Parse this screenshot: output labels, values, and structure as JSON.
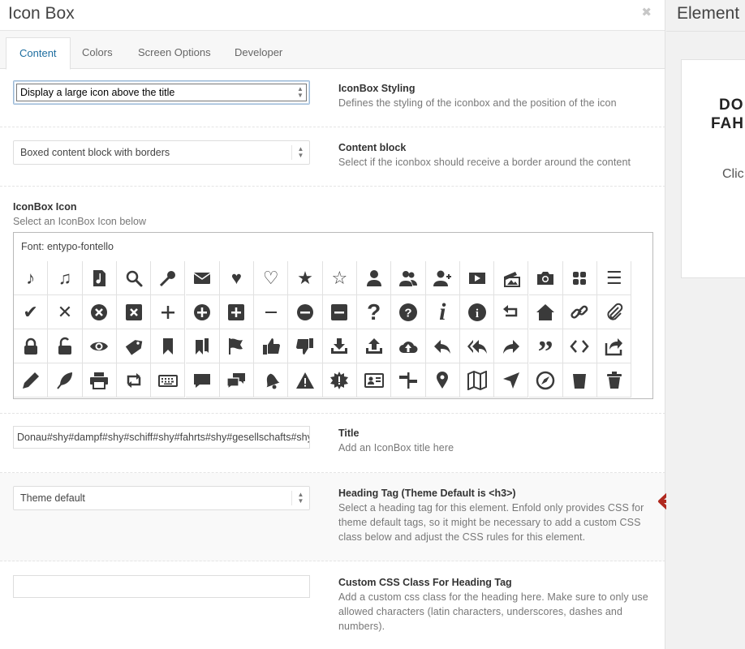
{
  "modal": {
    "title": "Icon Box",
    "close_symbol": "✖",
    "tabs": [
      {
        "label": "Content",
        "active": true
      },
      {
        "label": "Colors",
        "active": false
      },
      {
        "label": "Screen Options",
        "active": false
      },
      {
        "label": "Developer",
        "active": false
      }
    ]
  },
  "styling": {
    "selected": "Display a large icon above the title",
    "title": "IconBox Styling",
    "desc": "Defines the styling of the iconbox and the position of the icon"
  },
  "content_block": {
    "selected": "Boxed content block with borders",
    "title": "Content block",
    "desc": "Select if the iconbox should receive a border around the content"
  },
  "icon_section": {
    "title": "IconBox Icon",
    "desc": "Select an IconBox Icon below",
    "font_label": "Font: entypo-fontello",
    "icons": [
      "note-icon",
      "music-icon",
      "music-file-icon",
      "search-icon",
      "key-icon",
      "mail-icon",
      "heart-icon",
      "heart-outline-icon",
      "star-icon",
      "star-outline-icon",
      "user-icon",
      "users-icon",
      "user-add-icon",
      "video-icon",
      "picture-icon",
      "camera-icon",
      "grid-icon",
      "menu-icon",
      "check-icon",
      "cancel-icon",
      "cancel-circle-icon",
      "cancel-square-icon",
      "plus-icon",
      "plus-circle-icon",
      "plus-square-icon",
      "minus-icon",
      "minus-circle-icon",
      "minus-square-icon",
      "help-icon",
      "help-circle-icon",
      "info-icon",
      "info-circle-icon",
      "back-icon",
      "home-icon",
      "link-icon",
      "attach-icon",
      "lock-icon",
      "lock-open-icon",
      "eye-icon",
      "tag-icon",
      "bookmark-icon",
      "bookmarks-icon",
      "flag-icon",
      "thumbs-up-icon",
      "thumbs-down-icon",
      "download-icon",
      "upload-icon",
      "upload-cloud-icon",
      "reply-icon",
      "reply-all-icon",
      "forward-icon",
      "quote-icon",
      "code-icon",
      "export-icon",
      "pencil-icon",
      "feather-icon",
      "print-icon",
      "retweet-icon",
      "keyboard-icon",
      "comment-icon",
      "chat-icon",
      "bell-icon",
      "attention-icon",
      "alert-icon",
      "vcard-icon",
      "direction-icon",
      "location-icon",
      "map-icon",
      "navigation-icon",
      "compass-icon",
      "cup-icon",
      "trash-icon"
    ]
  },
  "title_field": {
    "value": "Donau#shy#dampf#shy#schiff#shy#fahrts#shy#gesellschafts#shy#",
    "title": "Title",
    "desc": "Add an IconBox title here"
  },
  "heading_tag": {
    "selected": "Theme default",
    "title": "Heading Tag (Theme Default is <h3>)",
    "desc": "Select a heading tag for this element. Enfold only provides CSS for theme default tags, so it might be necessary to add a custom CSS class below and adjust the CSS rules for this element."
  },
  "custom_css": {
    "value": "",
    "title": "Custom CSS Class For Heading Tag",
    "desc": "Add a custom css class for the heading here. Make sure to only use allowed characters (latin characters, underscores, dashes and numbers)."
  },
  "preview": {
    "title": "Element P",
    "line1": "DO",
    "line2": "FAH",
    "line3": "Clic"
  },
  "colors": {
    "accent": "#1e6ea0",
    "annotation_arrow": "#b0291f"
  }
}
